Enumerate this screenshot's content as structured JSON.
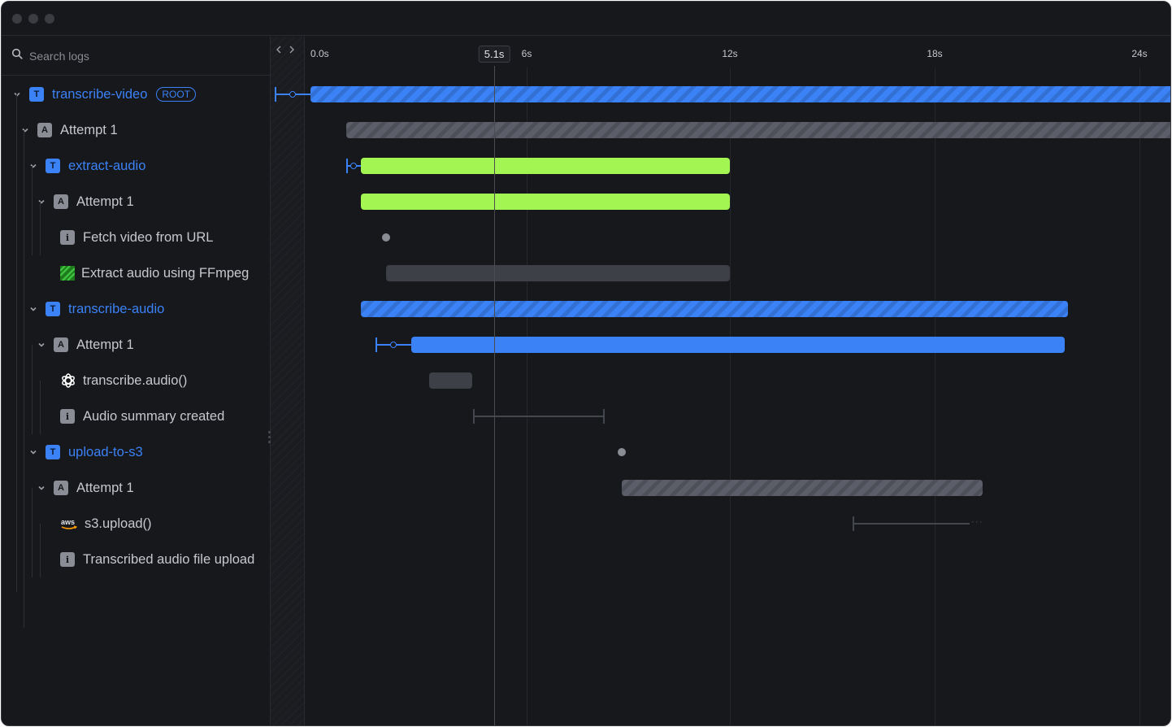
{
  "window": {
    "controls": [
      "close",
      "minimize",
      "maximize"
    ]
  },
  "search": {
    "icon": "search-icon",
    "placeholder": "Search logs",
    "value": ""
  },
  "nav": {
    "prev_icon": "chevron-left-icon",
    "next_icon": "chevron-right-icon"
  },
  "timeline": {
    "ticks": [
      "0.0s",
      "6s",
      "12s",
      "18s",
      "24s"
    ],
    "tick_values": [
      0,
      6,
      12,
      18,
      24
    ],
    "cursor_label": "5.1s",
    "cursor_value": 5.1,
    "unit": "s"
  },
  "tree": [
    {
      "label": "transcribe-video",
      "badge": "T",
      "kind": "task",
      "depth": 0,
      "expanded": true,
      "pill": "ROOT"
    },
    {
      "label": "Attempt 1",
      "badge": "A",
      "kind": "attempt",
      "depth": 1,
      "expanded": true
    },
    {
      "label": "extract-audio",
      "badge": "T",
      "kind": "task",
      "depth": 2,
      "expanded": true
    },
    {
      "label": "Attempt 1",
      "badge": "A",
      "kind": "attempt",
      "depth": 3,
      "expanded": true
    },
    {
      "label": "Fetch video from URL",
      "badge": "i",
      "kind": "log",
      "depth": 4,
      "icon": "info-icon"
    },
    {
      "label": "Extract audio using FFmpeg",
      "badge": "",
      "kind": "span",
      "depth": 4,
      "icon": "ffmpeg-icon"
    },
    {
      "label": "transcribe-audio",
      "badge": "T",
      "kind": "task",
      "depth": 2,
      "expanded": true
    },
    {
      "label": "Attempt 1",
      "badge": "A",
      "kind": "attempt",
      "depth": 3,
      "expanded": true
    },
    {
      "label": "transcribe.audio()",
      "badge": "",
      "kind": "span",
      "depth": 4,
      "icon": "openai-icon"
    },
    {
      "label": "Audio summary created",
      "badge": "i",
      "kind": "log",
      "depth": 4,
      "icon": "info-icon"
    },
    {
      "label": "upload-to-s3",
      "badge": "T",
      "kind": "task",
      "depth": 2,
      "expanded": true
    },
    {
      "label": "Attempt 1",
      "badge": "A",
      "kind": "attempt",
      "depth": 3,
      "expanded": true
    },
    {
      "label": "s3.upload()",
      "badge": "",
      "kind": "span",
      "depth": 4,
      "icon": "aws-icon"
    },
    {
      "label": "Transcribed audio file upload",
      "badge": "i",
      "kind": "log",
      "depth": 4,
      "icon": "info-icon"
    }
  ],
  "spans": [
    {
      "row": 0,
      "type": "bar",
      "style": "blue-striped",
      "start": 0.0,
      "end": 25.5,
      "queued_from": -1.0
    },
    {
      "row": 1,
      "type": "bar",
      "style": "gray-striped",
      "start": 1.0,
      "end": 25.3
    },
    {
      "row": 2,
      "type": "bar",
      "style": "green",
      "start": 1.4,
      "end": 12.0,
      "queued_from": 1.0
    },
    {
      "row": 3,
      "type": "bar",
      "style": "green",
      "start": 1.4,
      "end": 12.0
    },
    {
      "row": 4,
      "type": "point",
      "at": 2.1
    },
    {
      "row": 5,
      "type": "bar",
      "style": "dark",
      "start": 2.1,
      "end": 12.0
    },
    {
      "row": 6,
      "type": "bar",
      "style": "blue-striped",
      "start": 1.4,
      "end": 21.9
    },
    {
      "row": 7,
      "type": "bar",
      "style": "blue",
      "start": 2.8,
      "end": 21.8,
      "queued_from": 1.8
    },
    {
      "row": 8,
      "type": "bar",
      "style": "dark",
      "start": 3.3,
      "end": 4.5
    },
    {
      "row": 9,
      "type": "range",
      "start": 4.5,
      "end": 8.3
    },
    {
      "row": 10,
      "type": "point",
      "at": 8.8
    },
    {
      "row": 11,
      "type": "bar",
      "style": "gray-striped",
      "start": 8.8,
      "end": 19.4
    },
    {
      "row": 12,
      "type": "range-open",
      "start": 15.6,
      "end": 19.4
    }
  ],
  "colors": {
    "background": "#17181c",
    "accent_blue": "#3b82f6",
    "success_green": "#a3f552",
    "neutral_gray": "#5b5e68",
    "text": "#c7c8ce"
  }
}
